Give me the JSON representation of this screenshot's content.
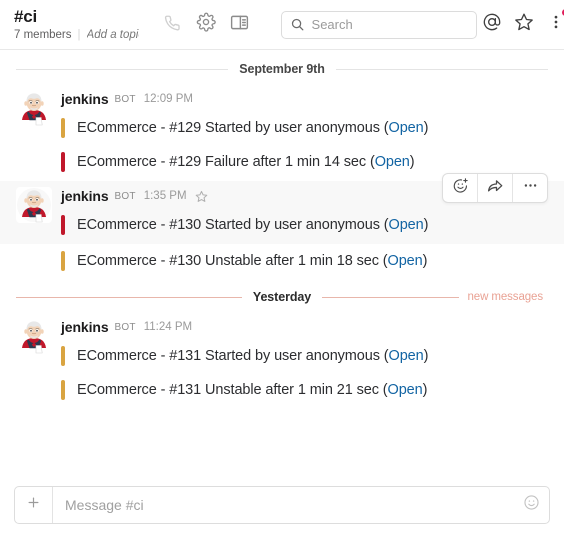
{
  "header": {
    "channel_name": "#ci",
    "members_text": "7 members",
    "separator": "|",
    "topic_placeholder": "Add a topic",
    "icons": {
      "call": "phone-icon",
      "settings": "gear-icon",
      "details": "panel-toggle-icon",
      "mentions": "at-mentions-icon",
      "starred": "star-icon",
      "more": "more-vertical-icon"
    }
  },
  "search": {
    "placeholder": "Search",
    "value": "",
    "icon": "search-icon"
  },
  "dividers": {
    "date_1": "September 9th",
    "date_2": "Yesterday",
    "new_messages": "new messages"
  },
  "hover_toolbar": {
    "add_reaction": "add-reaction-icon",
    "share": "share-icon",
    "more": "more-actions-icon"
  },
  "colors": {
    "status_started": "#d9a441",
    "status_failure": "#c0182b",
    "status_unstable": "#d9a441",
    "link": "#1264a3",
    "unread_accent": "#e8b6ab",
    "notification": "#e01e5a",
    "hover_bg": "#f8f8f8"
  },
  "groups": [
    {
      "author": "jenkins",
      "badge": "BOT",
      "timestamp": "12:09 PM",
      "hovered": false,
      "starred": false,
      "avatar": "jenkins-butler-avatar",
      "messages": [
        {
          "prefix": "ECommerce - #129 Started by user anonymous (",
          "link": "Open",
          "suffix": ")",
          "bar_color": "#d9a441",
          "status": "started"
        },
        {
          "prefix": "ECommerce - #129 Failure after 1 min 14 sec (",
          "link": "Open",
          "suffix": ")",
          "bar_color": "#c0182b",
          "status": "failure"
        }
      ]
    },
    {
      "author": "jenkins",
      "badge": "BOT",
      "timestamp": "1:35 PM",
      "hovered": true,
      "starred": true,
      "avatar": "jenkins-butler-avatar",
      "messages": [
        {
          "prefix": "ECommerce - #130 Started by user anonymous (",
          "link": "Open",
          "suffix": ")",
          "bar_color": "#c0182b",
          "status": "started"
        },
        {
          "prefix": "ECommerce - #130 Unstable after 1 min 18 sec (",
          "link": "Open",
          "suffix": ")",
          "bar_color": "#d9a441",
          "status": "unstable"
        }
      ]
    },
    {
      "author": "jenkins",
      "badge": "BOT",
      "timestamp": "11:24 PM",
      "hovered": false,
      "starred": false,
      "avatar": "jenkins-butler-avatar",
      "messages": [
        {
          "prefix": "ECommerce - #131 Started by user anonymous (",
          "link": "Open",
          "suffix": ")",
          "bar_color": "#d9a441",
          "status": "started"
        },
        {
          "prefix": "ECommerce - #131 Unstable after 1 min 21 sec (",
          "link": "Open",
          "suffix": ")",
          "bar_color": "#d9a441",
          "status": "unstable"
        }
      ]
    }
  ],
  "composer": {
    "placeholder": "Message #ci",
    "value": "",
    "add_icon": "plus-icon",
    "emoji_icon": "emoji-smiley-icon"
  }
}
